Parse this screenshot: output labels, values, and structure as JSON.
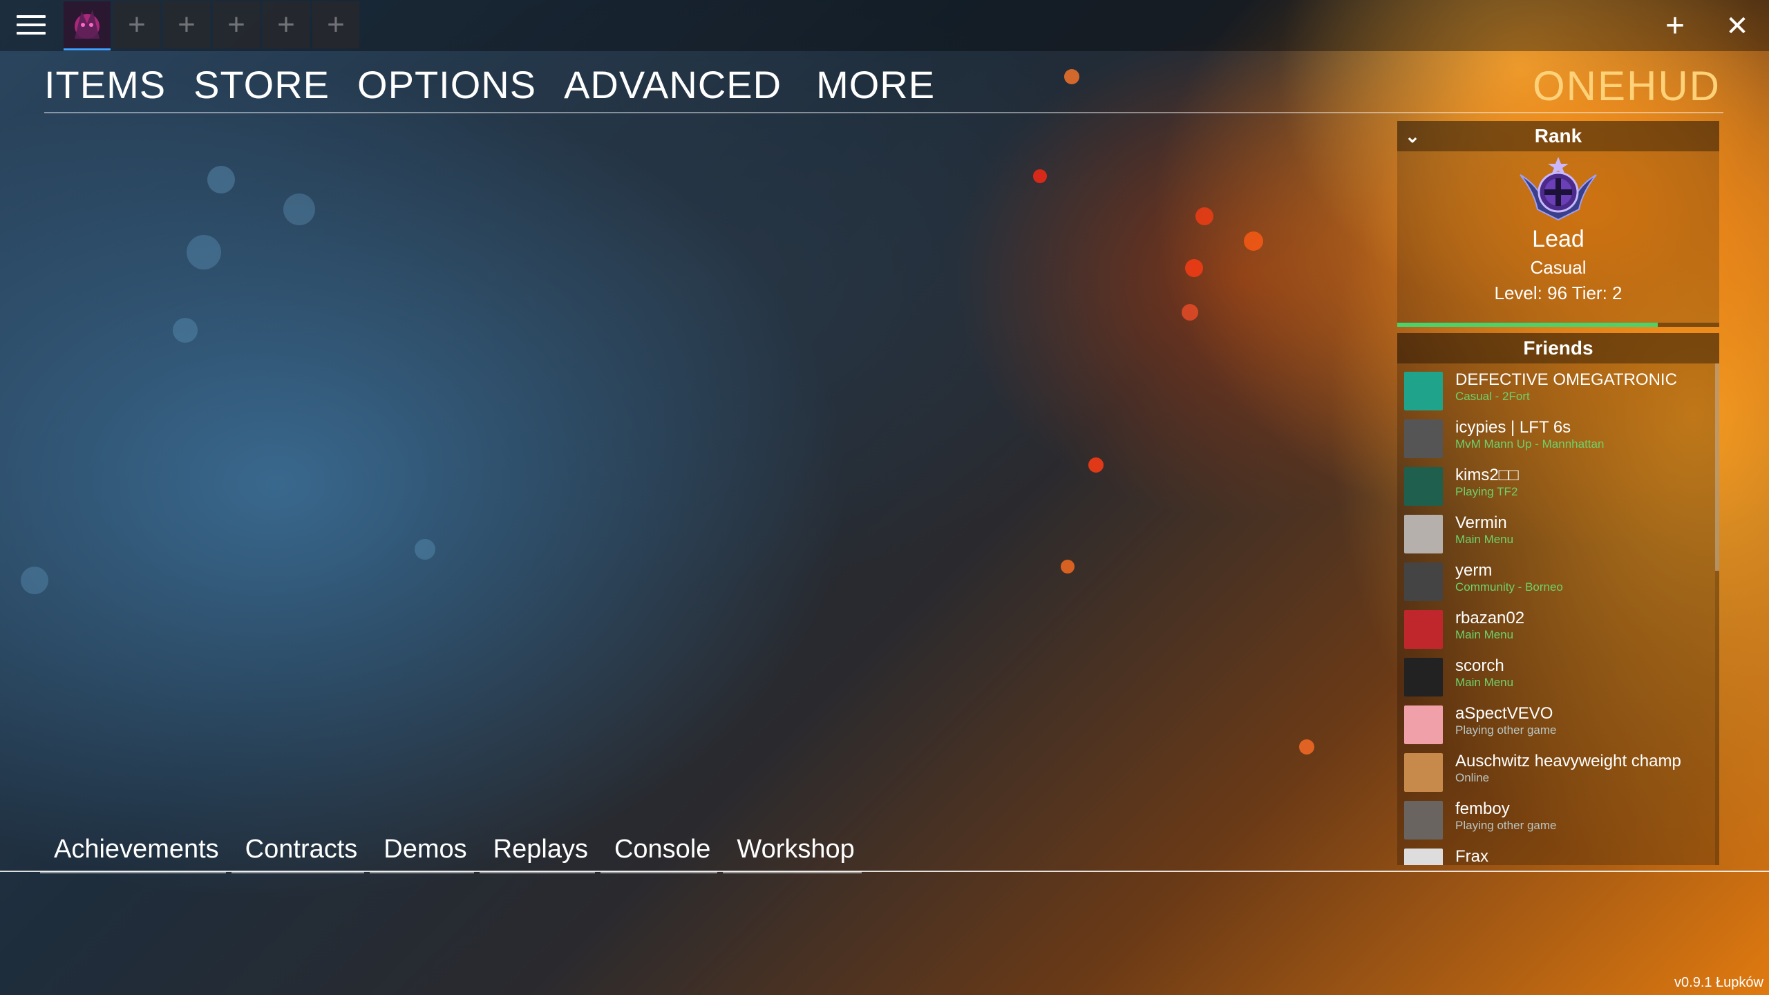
{
  "topbar": {
    "menu_icon": "hamburger-icon",
    "loadout_slots": [
      "class-portrait",
      "+",
      "+",
      "+",
      "+",
      "+"
    ],
    "add_icon": "+",
    "close_icon": "✕"
  },
  "nav": {
    "items": [
      "ITEMS",
      "STORE",
      "OPTIONS",
      "ADVANCED",
      "MORE"
    ],
    "brand": "ONEHUD"
  },
  "rank": {
    "header": "Rank",
    "collapse_icon": "chevron-down-icon",
    "name": "Lead",
    "mode": "Casual",
    "level_text": "Level: 96 Tier: 2",
    "xp_progress": 0.81
  },
  "friends": {
    "header": "Friends",
    "list": [
      {
        "name": "DEFECTIVE OMEGATRONIC",
        "status": "Casual - 2Fort",
        "color": "#1fa38a",
        "grey": false
      },
      {
        "name": "icypies | LFT 6s",
        "status": "MvM Mann Up - Mannhattan",
        "color": "#555555",
        "grey": false
      },
      {
        "name": "kims2□□",
        "status": "Playing TF2",
        "color": "#1e5f4e",
        "grey": false
      },
      {
        "name": "Vermin",
        "status": "Main Menu",
        "color": "#b5b0ab",
        "grey": false
      },
      {
        "name": "yerm",
        "status": "Community - Borneo",
        "color": "#444444",
        "grey": false
      },
      {
        "name": "rbazan02",
        "status": "Main Menu",
        "color": "#c0272d",
        "grey": false
      },
      {
        "name": "scorch",
        "status": "Main Menu",
        "color": "#222222",
        "grey": false
      },
      {
        "name": "aSpectVEVO",
        "status": "Playing other game",
        "color": "#f0a0a8",
        "grey": true
      },
      {
        "name": "Auschwitz heavyweight champ",
        "status": "Online",
        "color": "#c88a4a",
        "grey": true
      },
      {
        "name": "femboy",
        "status": "Playing other game",
        "color": "#6a6460",
        "grey": true
      },
      {
        "name": "Frax",
        "status": "",
        "color": "#dddddd",
        "grey": true
      }
    ]
  },
  "subnav": {
    "items": [
      "Achievements",
      "Contracts",
      "Demos",
      "Replays",
      "Console",
      "Workshop"
    ]
  },
  "version": "v0.9.1 Łupków",
  "colors": {
    "brand": "#ffd27a",
    "status_green": "#6ed36a",
    "xp_green": "#4ad36a"
  }
}
